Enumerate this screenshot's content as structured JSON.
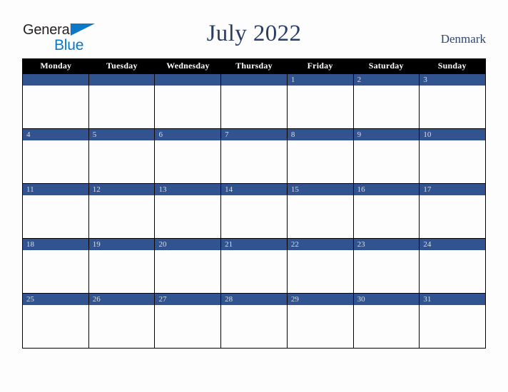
{
  "brand": {
    "word_one": "General",
    "word_two": "Blue",
    "triangle_icon": "blue-triangle-icon",
    "color_dark": "#231f20",
    "color_blue": "#0b78c8"
  },
  "header": {
    "title": "July 2022",
    "country": "Denmark",
    "title_color": "#2b3d63",
    "country_color": "#2f4670"
  },
  "calendar": {
    "month": "July",
    "year": "2022",
    "weekday_headers": [
      "Monday",
      "Tuesday",
      "Wednesday",
      "Thursday",
      "Friday",
      "Saturday",
      "Sunday"
    ],
    "header_bg": "#000000",
    "header_fg": "#ffffff",
    "day_bar_bg": "#31538f",
    "day_bar_fg": "#dcdfe6",
    "cell_bg": "#fdfdfd",
    "grid_line": "#000000",
    "weeks": [
      {
        "days": [
          {
            "num": ""
          },
          {
            "num": ""
          },
          {
            "num": ""
          },
          {
            "num": ""
          },
          {
            "num": "1"
          },
          {
            "num": "2"
          },
          {
            "num": "3"
          }
        ]
      },
      {
        "days": [
          {
            "num": "4"
          },
          {
            "num": "5"
          },
          {
            "num": "6"
          },
          {
            "num": "7"
          },
          {
            "num": "8"
          },
          {
            "num": "9"
          },
          {
            "num": "10"
          }
        ]
      },
      {
        "days": [
          {
            "num": "11"
          },
          {
            "num": "12"
          },
          {
            "num": "13"
          },
          {
            "num": "14"
          },
          {
            "num": "15"
          },
          {
            "num": "16"
          },
          {
            "num": "17"
          }
        ]
      },
      {
        "days": [
          {
            "num": "18"
          },
          {
            "num": "19"
          },
          {
            "num": "20"
          },
          {
            "num": "21"
          },
          {
            "num": "22"
          },
          {
            "num": "23"
          },
          {
            "num": "24"
          }
        ]
      },
      {
        "days": [
          {
            "num": "25"
          },
          {
            "num": "26"
          },
          {
            "num": "27"
          },
          {
            "num": "28"
          },
          {
            "num": "29"
          },
          {
            "num": "30"
          },
          {
            "num": "31"
          }
        ]
      }
    ]
  }
}
